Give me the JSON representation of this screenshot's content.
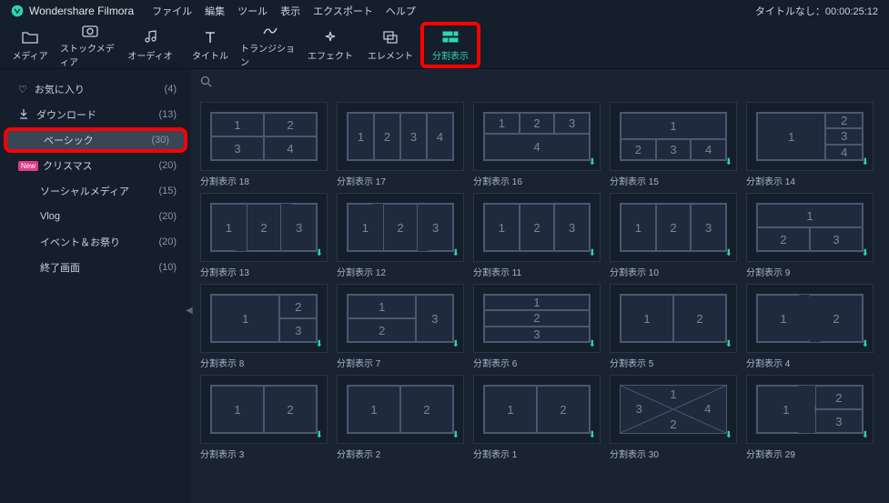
{
  "app": {
    "name": "Wondershare Filmora",
    "project_status": "タイトルなし：00:00:25:12"
  },
  "menu": [
    "ファイル",
    "編集",
    "ツール",
    "表示",
    "エクスポート",
    "ヘルプ"
  ],
  "toolbar": [
    {
      "id": "media",
      "label": "メディア"
    },
    {
      "id": "stock",
      "label": "ストックメディア"
    },
    {
      "id": "audio",
      "label": "オーディオ"
    },
    {
      "id": "title",
      "label": "タイトル"
    },
    {
      "id": "transition",
      "label": "トランジション"
    },
    {
      "id": "effect",
      "label": "エフェクト"
    },
    {
      "id": "element",
      "label": "エレメント"
    },
    {
      "id": "split",
      "label": "分割表示",
      "active": true
    }
  ],
  "sidebar": {
    "favorites": {
      "label": "お気に入り",
      "count": "(4)"
    },
    "download": {
      "label": "ダウンロード",
      "count": "(13)"
    },
    "basic": {
      "label": "ベーシック",
      "count": "(30)"
    },
    "christmas": {
      "label": "クリスマス",
      "count": "(20)",
      "new": "New"
    },
    "social": {
      "label": "ソーシャルメディア",
      "count": "(15)"
    },
    "vlog": {
      "label": "Vlog",
      "count": "(20)"
    },
    "event": {
      "label": "イベント＆お祭り",
      "count": "(20)"
    },
    "endscreen": {
      "label": "終了画面",
      "count": "(10)"
    }
  },
  "tiles": {
    "r1": [
      "分割表示 18",
      "分割表示 17",
      "分割表示 16",
      "分割表示 15",
      "分割表示 14"
    ],
    "r2": [
      "分割表示 13",
      "分割表示 12",
      "分割表示 11",
      "分割表示 10",
      "分割表示 9"
    ],
    "r3": [
      "分割表示 8",
      "分割表示 7",
      "分割表示 6",
      "分割表示 5",
      "分割表示 4"
    ],
    "r4": [
      "分割表示 3",
      "分割表示 2",
      "分割表示 1",
      "分割表示 30",
      "分割表示 29"
    ]
  }
}
